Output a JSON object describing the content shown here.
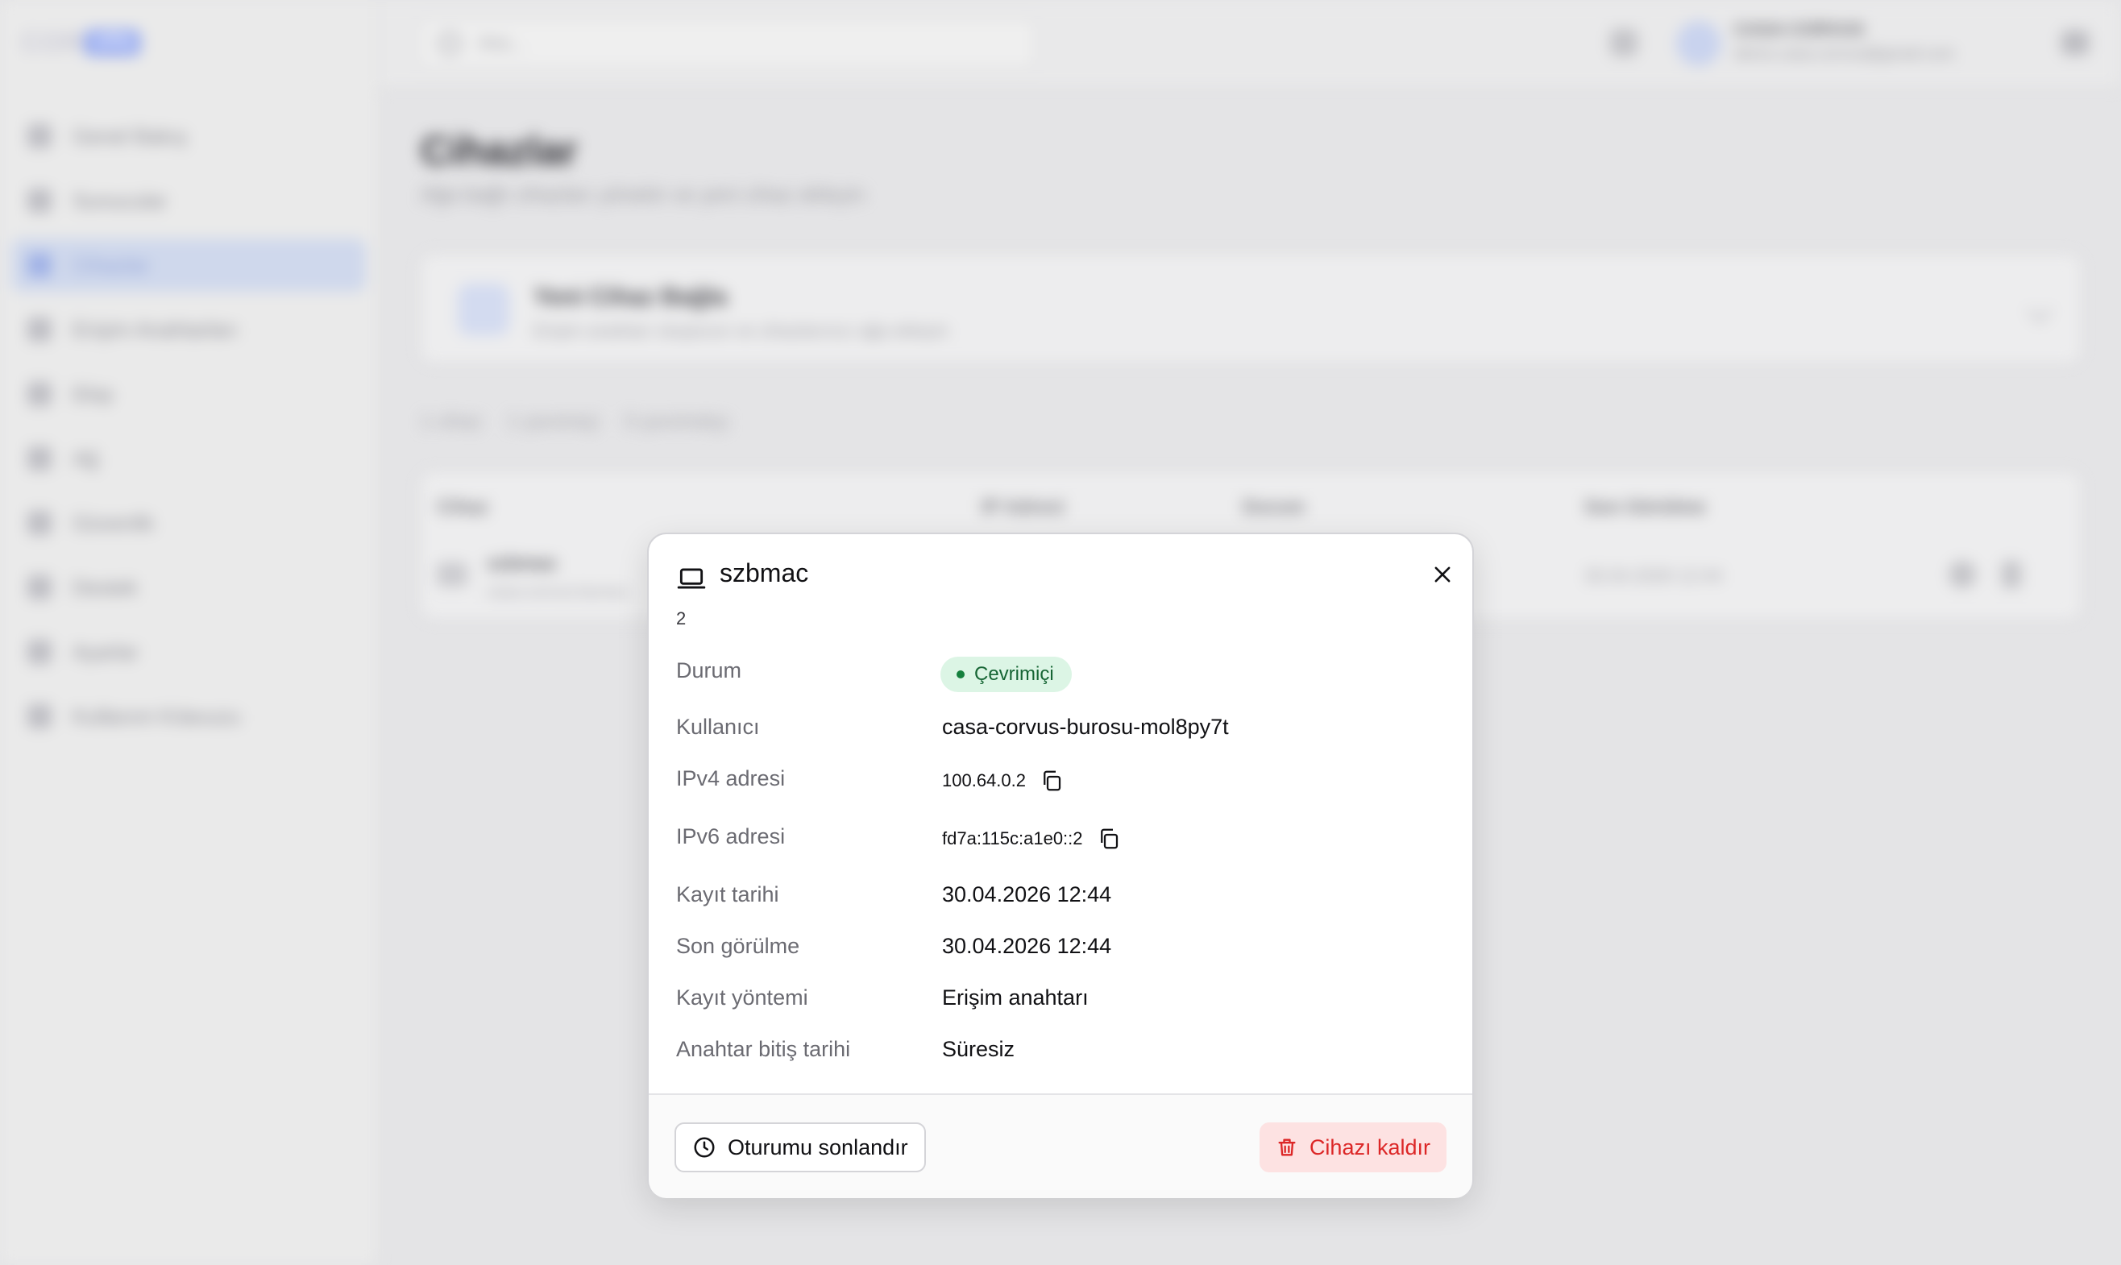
{
  "app": {
    "logo_text": "COR",
    "logo_badge": "VPN",
    "search_placeholder": "Ara...",
    "user_name": "CASA CORVUS",
    "user_email": "demo.casa.corvus@gmail.com",
    "nav": [
      {
        "label": "Genel Bakış"
      },
      {
        "label": "Sunucular"
      },
      {
        "label": "Cihazlar"
      },
      {
        "label": "Erişim Anahtarları"
      },
      {
        "label": "Ekip"
      },
      {
        "label": "Ağ"
      },
      {
        "label": "Güvenlik"
      },
      {
        "label": "Destek"
      },
      {
        "label": "Ayarlar"
      },
      {
        "label": "Kullanım Kılavuzu"
      }
    ],
    "page_title": "Cihazlar",
    "page_subtitle": "Ağa bağlı cihazları yönetin ve yeni cihaz ekleyin",
    "new_device_title": "Yeni Cihaz Bağla",
    "new_device_subtitle": "Erişim anahtarı oluşturun ve cihazlarınızı ağa ekleyin",
    "stats": [
      "1 cihaz",
      "1 çevrimiçi",
      "0 çevrimdışı"
    ],
    "table_headers": [
      "Cihaz",
      "IP Adresi",
      "Durum",
      "Son Görülme"
    ],
    "row": {
      "name": "szbmac",
      "sub": "casa-corvus-burosu",
      "last_seen": "30.04.2026 12:44"
    }
  },
  "modal": {
    "title": "szbmac",
    "id": "2",
    "fields": {
      "status_label": "Durum",
      "status_value": "Çevrimiçi",
      "user_label": "Kullanıcı",
      "user_value": "casa-corvus-burosu-mol8py7t",
      "ipv4_label": "IPv4 adresi",
      "ipv4_value": "100.64.0.2",
      "ipv6_label": "IPv6 adresi",
      "ipv6_value": "fd7a:115c:a1e0::2",
      "registered_label": "Kayıt tarihi",
      "registered_value": "30.04.2026 12:44",
      "last_seen_label": "Son görülme",
      "last_seen_value": "30.04.2026 12:44",
      "method_label": "Kayıt yöntemi",
      "method_value": "Erişim anahtarı",
      "expiry_label": "Anahtar bitiş tarihi",
      "expiry_value": "Süresiz"
    },
    "end_session_label": "Oturumu sonlandır",
    "remove_device_label": "Cihazı kaldır"
  },
  "colors": {
    "status_badge_bg": "#dcf5e5",
    "status_badge_text": "#166534",
    "danger": "#dc2626",
    "danger_bg": "#fde2e2"
  }
}
